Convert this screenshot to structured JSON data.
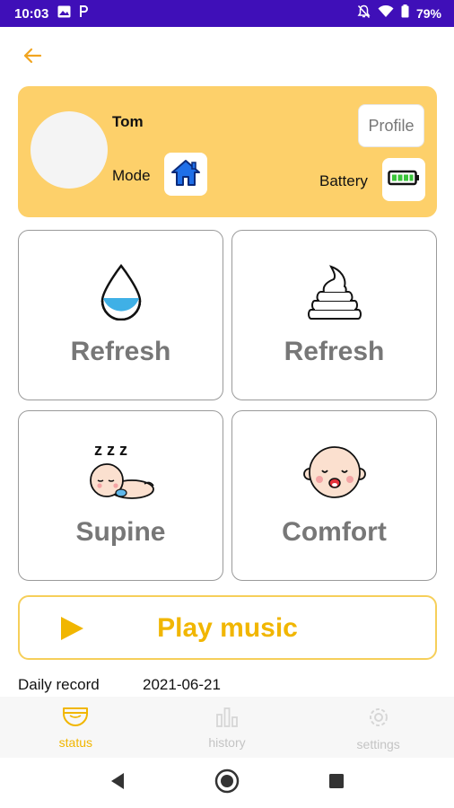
{
  "status_bar": {
    "time": "10:03",
    "battery_percent": "79%",
    "icons": [
      "image-icon",
      "parking-icon",
      "notifications-off-icon",
      "wifi-icon",
      "battery-icon"
    ]
  },
  "header": {
    "back_icon": "arrow-left-icon"
  },
  "profile": {
    "name": "Tom",
    "mode_label": "Mode",
    "mode_icon": "home-icon",
    "profile_button": "Profile",
    "battery_label": "Battery",
    "battery_icon": "battery-full-icon"
  },
  "tiles": [
    {
      "label": "Refresh",
      "icon": "water-drop-icon"
    },
    {
      "label": "Refresh",
      "icon": "poop-icon"
    },
    {
      "label": "Supine",
      "icon": "sleeping-baby-icon"
    },
    {
      "label": "Comfort",
      "icon": "crying-baby-icon"
    }
  ],
  "play": {
    "label": "Play music",
    "icon": "play-icon"
  },
  "daily": {
    "label": "Daily record",
    "date": "2021-06-21"
  },
  "tabs": [
    {
      "label": "status",
      "icon": "diaper-icon",
      "active": true
    },
    {
      "label": "history",
      "icon": "bar-chart-icon",
      "active": false
    },
    {
      "label": "settings",
      "icon": "gear-icon",
      "active": false
    }
  ],
  "nav": [
    "back-triangle-icon",
    "home-circle-icon",
    "recents-square-icon"
  ],
  "colors": {
    "status_bar": "#3f0fb8",
    "card": "#fdd06a",
    "accent": "#f1b600",
    "tile_border": "#9a9a9a"
  }
}
